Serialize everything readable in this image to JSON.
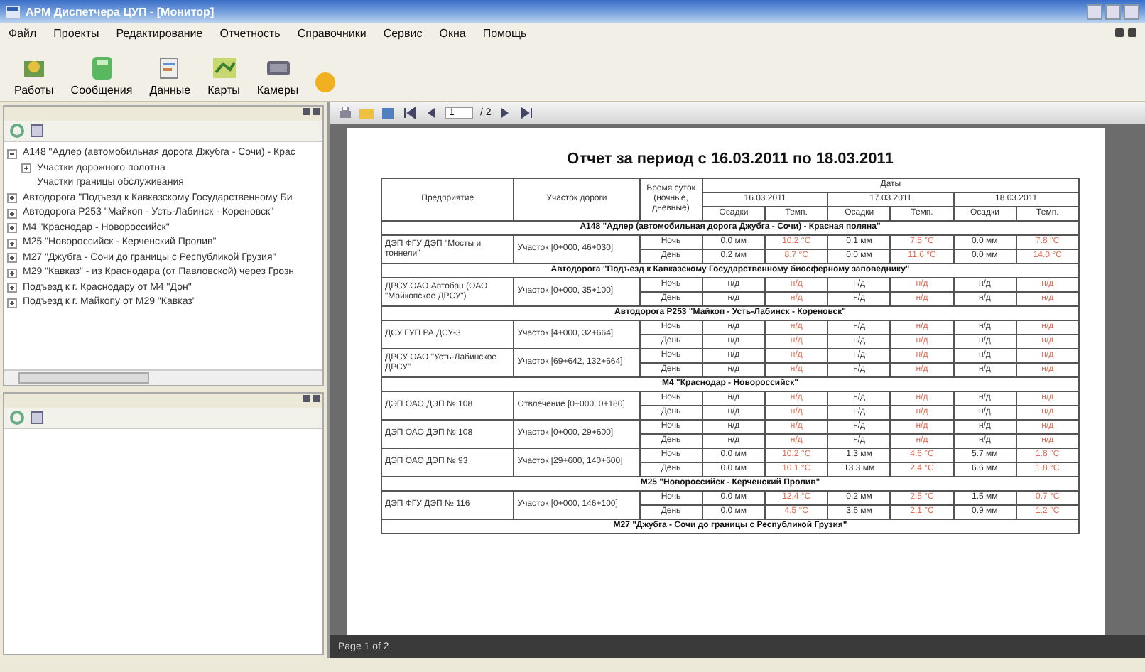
{
  "window": {
    "title": "АРМ Диспетчера ЦУП - [Монитор]"
  },
  "menu": [
    "Файл",
    "Проекты",
    "Редактирование",
    "Отчетность",
    "Справочники",
    "Сервис",
    "Окна",
    "Помощь"
  ],
  "toolbar": [
    "Работы",
    "Сообщения",
    "Данные",
    "Карты",
    "Камеры"
  ],
  "tree": [
    {
      "label": "А148 \"Адлер (автомобильная дорога Джубга - Сочи) - Крас",
      "expanded": true,
      "children": [
        {
          "label": "Участки дорожного полотна",
          "kind": "node"
        },
        {
          "label": "Участки границы обслуживания",
          "kind": "leaf"
        }
      ]
    },
    {
      "label": "Автодорога \"Подъезд к Кавказскому Государственному Би",
      "expanded": false
    },
    {
      "label": "Автодорога Р253 \"Майкоп - Усть-Лабинск - Кореновск\"",
      "expanded": false
    },
    {
      "label": "М4 \"Краснодар - Новороссийск\"",
      "expanded": false
    },
    {
      "label": "М25 \"Новороссийск - Керченский Пролив\"",
      "expanded": false
    },
    {
      "label": "М27 \"Джубга - Сочи до границы с Республикой Грузия\"",
      "expanded": false
    },
    {
      "label": "М29 \"Кавказ\" - из Краснодара (от Павловской) через Грозн",
      "expanded": false
    },
    {
      "label": "Подъезд к г. Краснодару от М4 \"Дон\"",
      "expanded": false
    },
    {
      "label": "Подъезд к г. Майкопу от М29 \"Кавказ\"",
      "expanded": false
    }
  ],
  "viewer": {
    "page_field": "1",
    "page_total": "/ 2"
  },
  "report": {
    "title": "Отчет за период с 16.03.2011 по 18.03.2011",
    "columns": [
      "Предприятие",
      "Участок дороги",
      "Время суток (ночные, дневные)",
      "Даты"
    ],
    "dates": [
      {
        "date": "16.03.2011",
        "subcolumns": [
          "Осадки",
          "Темп."
        ]
      },
      {
        "date": "17.03.2011",
        "subcolumns": [
          "Осадки",
          "Темп."
        ]
      },
      {
        "date": "18.03.2011",
        "subcolumns": [
          "Осадки",
          "Темп."
        ]
      }
    ],
    "sections": [
      {
        "title": "А148 \"Адлер (автомобильная дорога Джубга - Сочи) - Красная поляна\"",
        "rows": [
          {
            "enterprise": "ДЭП ФГУ ДЭП \"Мосты и тоннели\"",
            "segment": "Участок [0+000, 46+030]",
            "periods": [
              {
                "label": "Ночь",
                "values": [
                  "0.0 мм",
                  "10.2 °C",
                  "0.1 мм",
                  "7.5 °C",
                  "0.0 мм",
                  "7.8 °C"
                ]
              },
              {
                "label": "День",
                "values": [
                  "0.2 мм",
                  "8.7 °C",
                  "0.0 мм",
                  "11.6 °C",
                  "0.0 мм",
                  "14.0 °C"
                ]
              }
            ]
          }
        ]
      },
      {
        "title": "Автодорога \"Подъезд к Кавказскому Государственному биосферному заповеднику\"",
        "rows": [
          {
            "enterprise": "ДРСУ ОАО Автобан (ОАО \"Майкопское ДРСУ\")",
            "segment": "Участок [0+000, 35+100]",
            "periods": [
              {
                "label": "Ночь",
                "values": [
                  "н/д",
                  "н/д",
                  "н/д",
                  "н/д",
                  "н/д",
                  "н/д"
                ]
              },
              {
                "label": "День",
                "values": [
                  "н/д",
                  "н/д",
                  "н/д",
                  "н/д",
                  "н/д",
                  "н/д"
                ]
              }
            ]
          }
        ]
      },
      {
        "title": "Автодорога Р253 \"Майкоп - Усть-Лабинск - Кореновск\"",
        "rows": [
          {
            "enterprise": "ДСУ ГУП РА ДСУ-3",
            "segment": "Участок [4+000, 32+664]",
            "periods": [
              {
                "label": "Ночь",
                "values": [
                  "н/д",
                  "н/д",
                  "н/д",
                  "н/д",
                  "н/д",
                  "н/д"
                ]
              },
              {
                "label": "День",
                "values": [
                  "н/д",
                  "н/д",
                  "н/д",
                  "н/д",
                  "н/д",
                  "н/д"
                ]
              }
            ]
          },
          {
            "enterprise": "ДРСУ ОАО \"Усть-Лабинское ДРСУ\"",
            "segment": "Участок [69+642, 132+664]",
            "periods": [
              {
                "label": "Ночь",
                "values": [
                  "н/д",
                  "н/д",
                  "н/д",
                  "н/д",
                  "н/д",
                  "н/д"
                ]
              },
              {
                "label": "День",
                "values": [
                  "н/д",
                  "н/д",
                  "н/д",
                  "н/д",
                  "н/д",
                  "н/д"
                ]
              }
            ]
          }
        ]
      },
      {
        "title": "М4 \"Краснодар - Новороссийск\"",
        "rows": [
          {
            "enterprise": "ДЭП ОАО ДЭП № 108",
            "segment": "Отвлечение [0+000, 0+180]",
            "periods": [
              {
                "label": "Ночь",
                "values": [
                  "н/д",
                  "н/д",
                  "н/д",
                  "н/д",
                  "н/д",
                  "н/д"
                ]
              },
              {
                "label": "День",
                "values": [
                  "н/д",
                  "н/д",
                  "н/д",
                  "н/д",
                  "н/д",
                  "н/д"
                ]
              }
            ]
          },
          {
            "enterprise": "ДЭП ОАО ДЭП № 108",
            "segment": "Участок [0+000, 29+600]",
            "periods": [
              {
                "label": "Ночь",
                "values": [
                  "н/д",
                  "н/д",
                  "н/д",
                  "н/д",
                  "н/д",
                  "н/д"
                ]
              },
              {
                "label": "День",
                "values": [
                  "н/д",
                  "н/д",
                  "н/д",
                  "н/д",
                  "н/д",
                  "н/д"
                ]
              }
            ]
          },
          {
            "enterprise": "ДЭП ОАО ДЭП № 93",
            "segment": "Участок [29+600, 140+600]",
            "periods": [
              {
                "label": "Ночь",
                "values": [
                  "0.0 мм",
                  "10.2 °C",
                  "1.3 мм",
                  "4.6 °C",
                  "5.7 мм",
                  "1.8 °C"
                ]
              },
              {
                "label": "День",
                "values": [
                  "0.0 мм",
                  "10.1 °C",
                  "13.3 мм",
                  "2.4 °C",
                  "6.6 мм",
                  "1.8 °C"
                ]
              }
            ]
          }
        ]
      },
      {
        "title": "М25 \"Новороссийск - Керченский Пролив\"",
        "rows": [
          {
            "enterprise": "ДЭП ФГУ ДЭП № 116",
            "segment": "Участок [0+000, 146+100]",
            "periods": [
              {
                "label": "Ночь",
                "values": [
                  "0.0 мм",
                  "12.4 °C",
                  "0.2 мм",
                  "2.5 °C",
                  "1.5 мм",
                  "0.7 °C"
                ]
              },
              {
                "label": "День",
                "values": [
                  "0.0 мм",
                  "4.5 °C",
                  "3.6 мм",
                  "2.1 °C",
                  "0.9 мм",
                  "1.2 °C"
                ]
              }
            ]
          }
        ]
      },
      {
        "title": "М27 \"Джубга - Сочи до границы с Республикой Грузия\""
      }
    ]
  },
  "status_bar": {
    "page": "Page 1 of 2"
  }
}
